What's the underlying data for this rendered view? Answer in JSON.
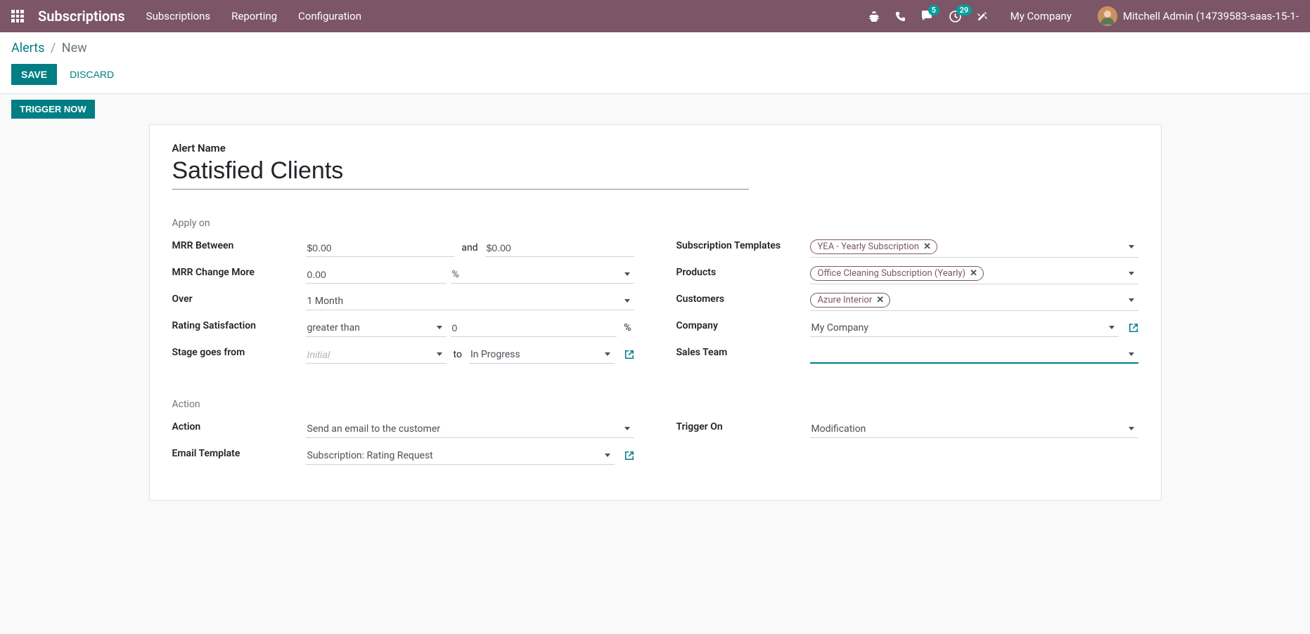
{
  "navbar": {
    "brand": "Subscriptions",
    "links": [
      "Subscriptions",
      "Reporting",
      "Configuration"
    ],
    "messages_badge": "5",
    "activities_badge": "29",
    "company": "My Company",
    "user_name": "Mitchell Admin (14739583-saas-15-1-"
  },
  "breadcrumb": {
    "parent": "Alerts",
    "current": "New"
  },
  "buttons": {
    "save": "SAVE",
    "discard": "DISCARD",
    "trigger_now": "TRIGGER NOW"
  },
  "form": {
    "title_label": "Alert Name",
    "title_value": "Satisfied Clients",
    "section_apply": "Apply on",
    "section_action": "Action",
    "labels": {
      "mrr_between": "MRR Between",
      "mrr_and": "and",
      "mrr_change": "MRR Change More",
      "over": "Over",
      "rating": "Rating Satisfaction",
      "stage": "Stage goes from",
      "stage_to": "to",
      "sub_templates": "Subscription Templates",
      "products": "Products",
      "customers": "Customers",
      "company": "Company",
      "sales_team": "Sales Team",
      "action": "Action",
      "email_template": "Email Template",
      "trigger_on": "Trigger On"
    },
    "values": {
      "mrr_from": "$0.00",
      "mrr_to": "$0.00",
      "mrr_change_val": "0.00",
      "mrr_change_unit": "%",
      "over": "1 Month",
      "rating_op": "greater than",
      "rating_val": "0",
      "rating_unit": "%",
      "stage_from_placeholder": "Initial",
      "stage_to": "In Progress",
      "company": "My Company",
      "sales_team": "",
      "action": "Send an email to the customer",
      "email_template": "Subscription: Rating Request",
      "trigger_on": "Modification"
    },
    "tags": {
      "sub_templates": [
        "YEA - Yearly Subscription"
      ],
      "products": [
        "Office Cleaning Subscription (Yearly)"
      ],
      "customers": [
        "Azure Interior"
      ]
    }
  }
}
